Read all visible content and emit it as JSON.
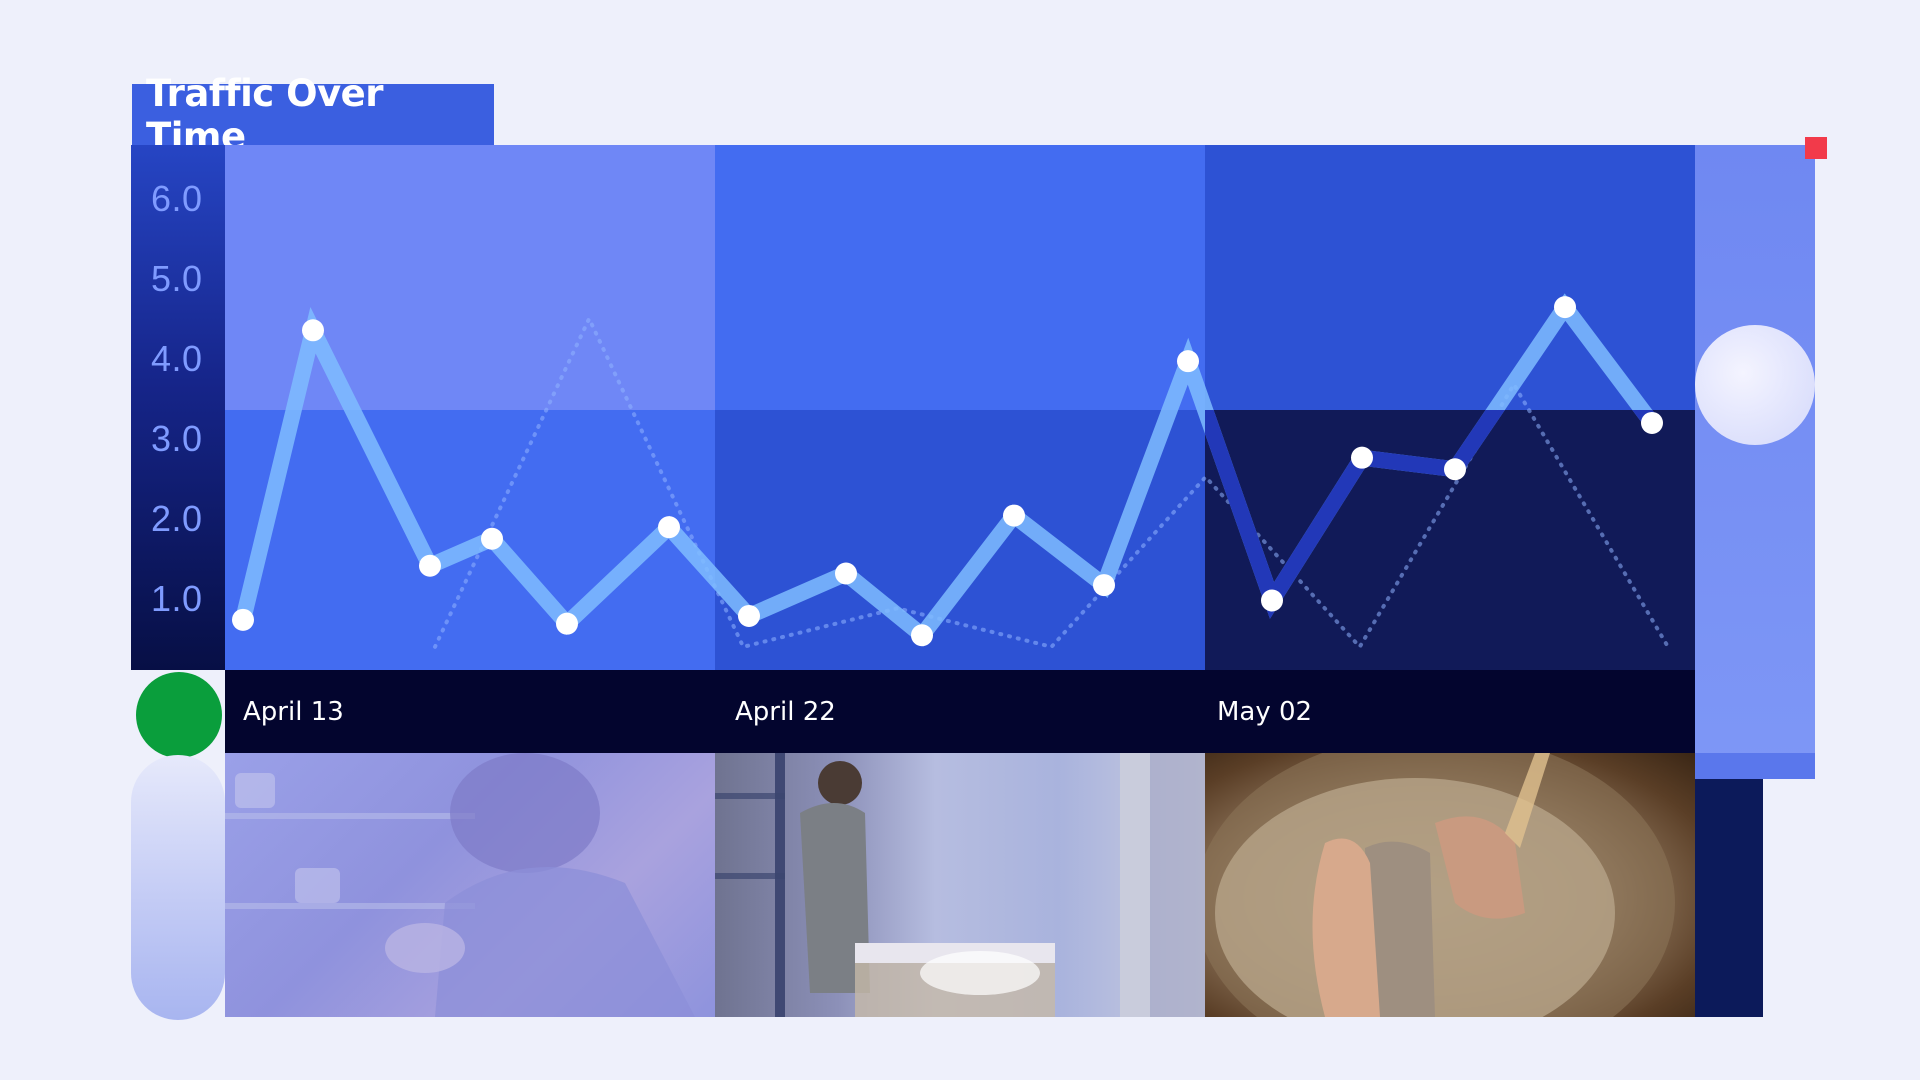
{
  "chart_data": {
    "type": "line",
    "title": "Traffic Over Time",
    "y_ticks": [
      "6.0",
      "5.0",
      "4.0",
      "3.0",
      "2.0",
      "1.0"
    ],
    "ylim": [
      0,
      6.8
    ],
    "x_labels": [
      "April 13",
      "April 22",
      "May 02"
    ],
    "series": [
      {
        "values": [
          0.65,
          4.4,
          1.35,
          1.7,
          0.6,
          1.85,
          0.7,
          1.25,
          0.45,
          2.0,
          1.1,
          4.0,
          0.9,
          2.75,
          2.6,
          4.7,
          3.2
        ]
      }
    ],
    "background_series": [
      0.3,
      4.55,
      0.3,
      0.8,
      0.3,
      2.5,
      0.3,
      3.7,
      0.3
    ]
  },
  "colors": {
    "line": "#7fbcff",
    "line_dark_region": "#2238b8",
    "point": "#ffffff",
    "block_light": "#6f87f6",
    "block_mid": "#436cf1",
    "block_dark": "#2d52d4",
    "block_darker": "#111a58"
  },
  "images": [
    "photo-1",
    "photo-2",
    "photo-3"
  ]
}
